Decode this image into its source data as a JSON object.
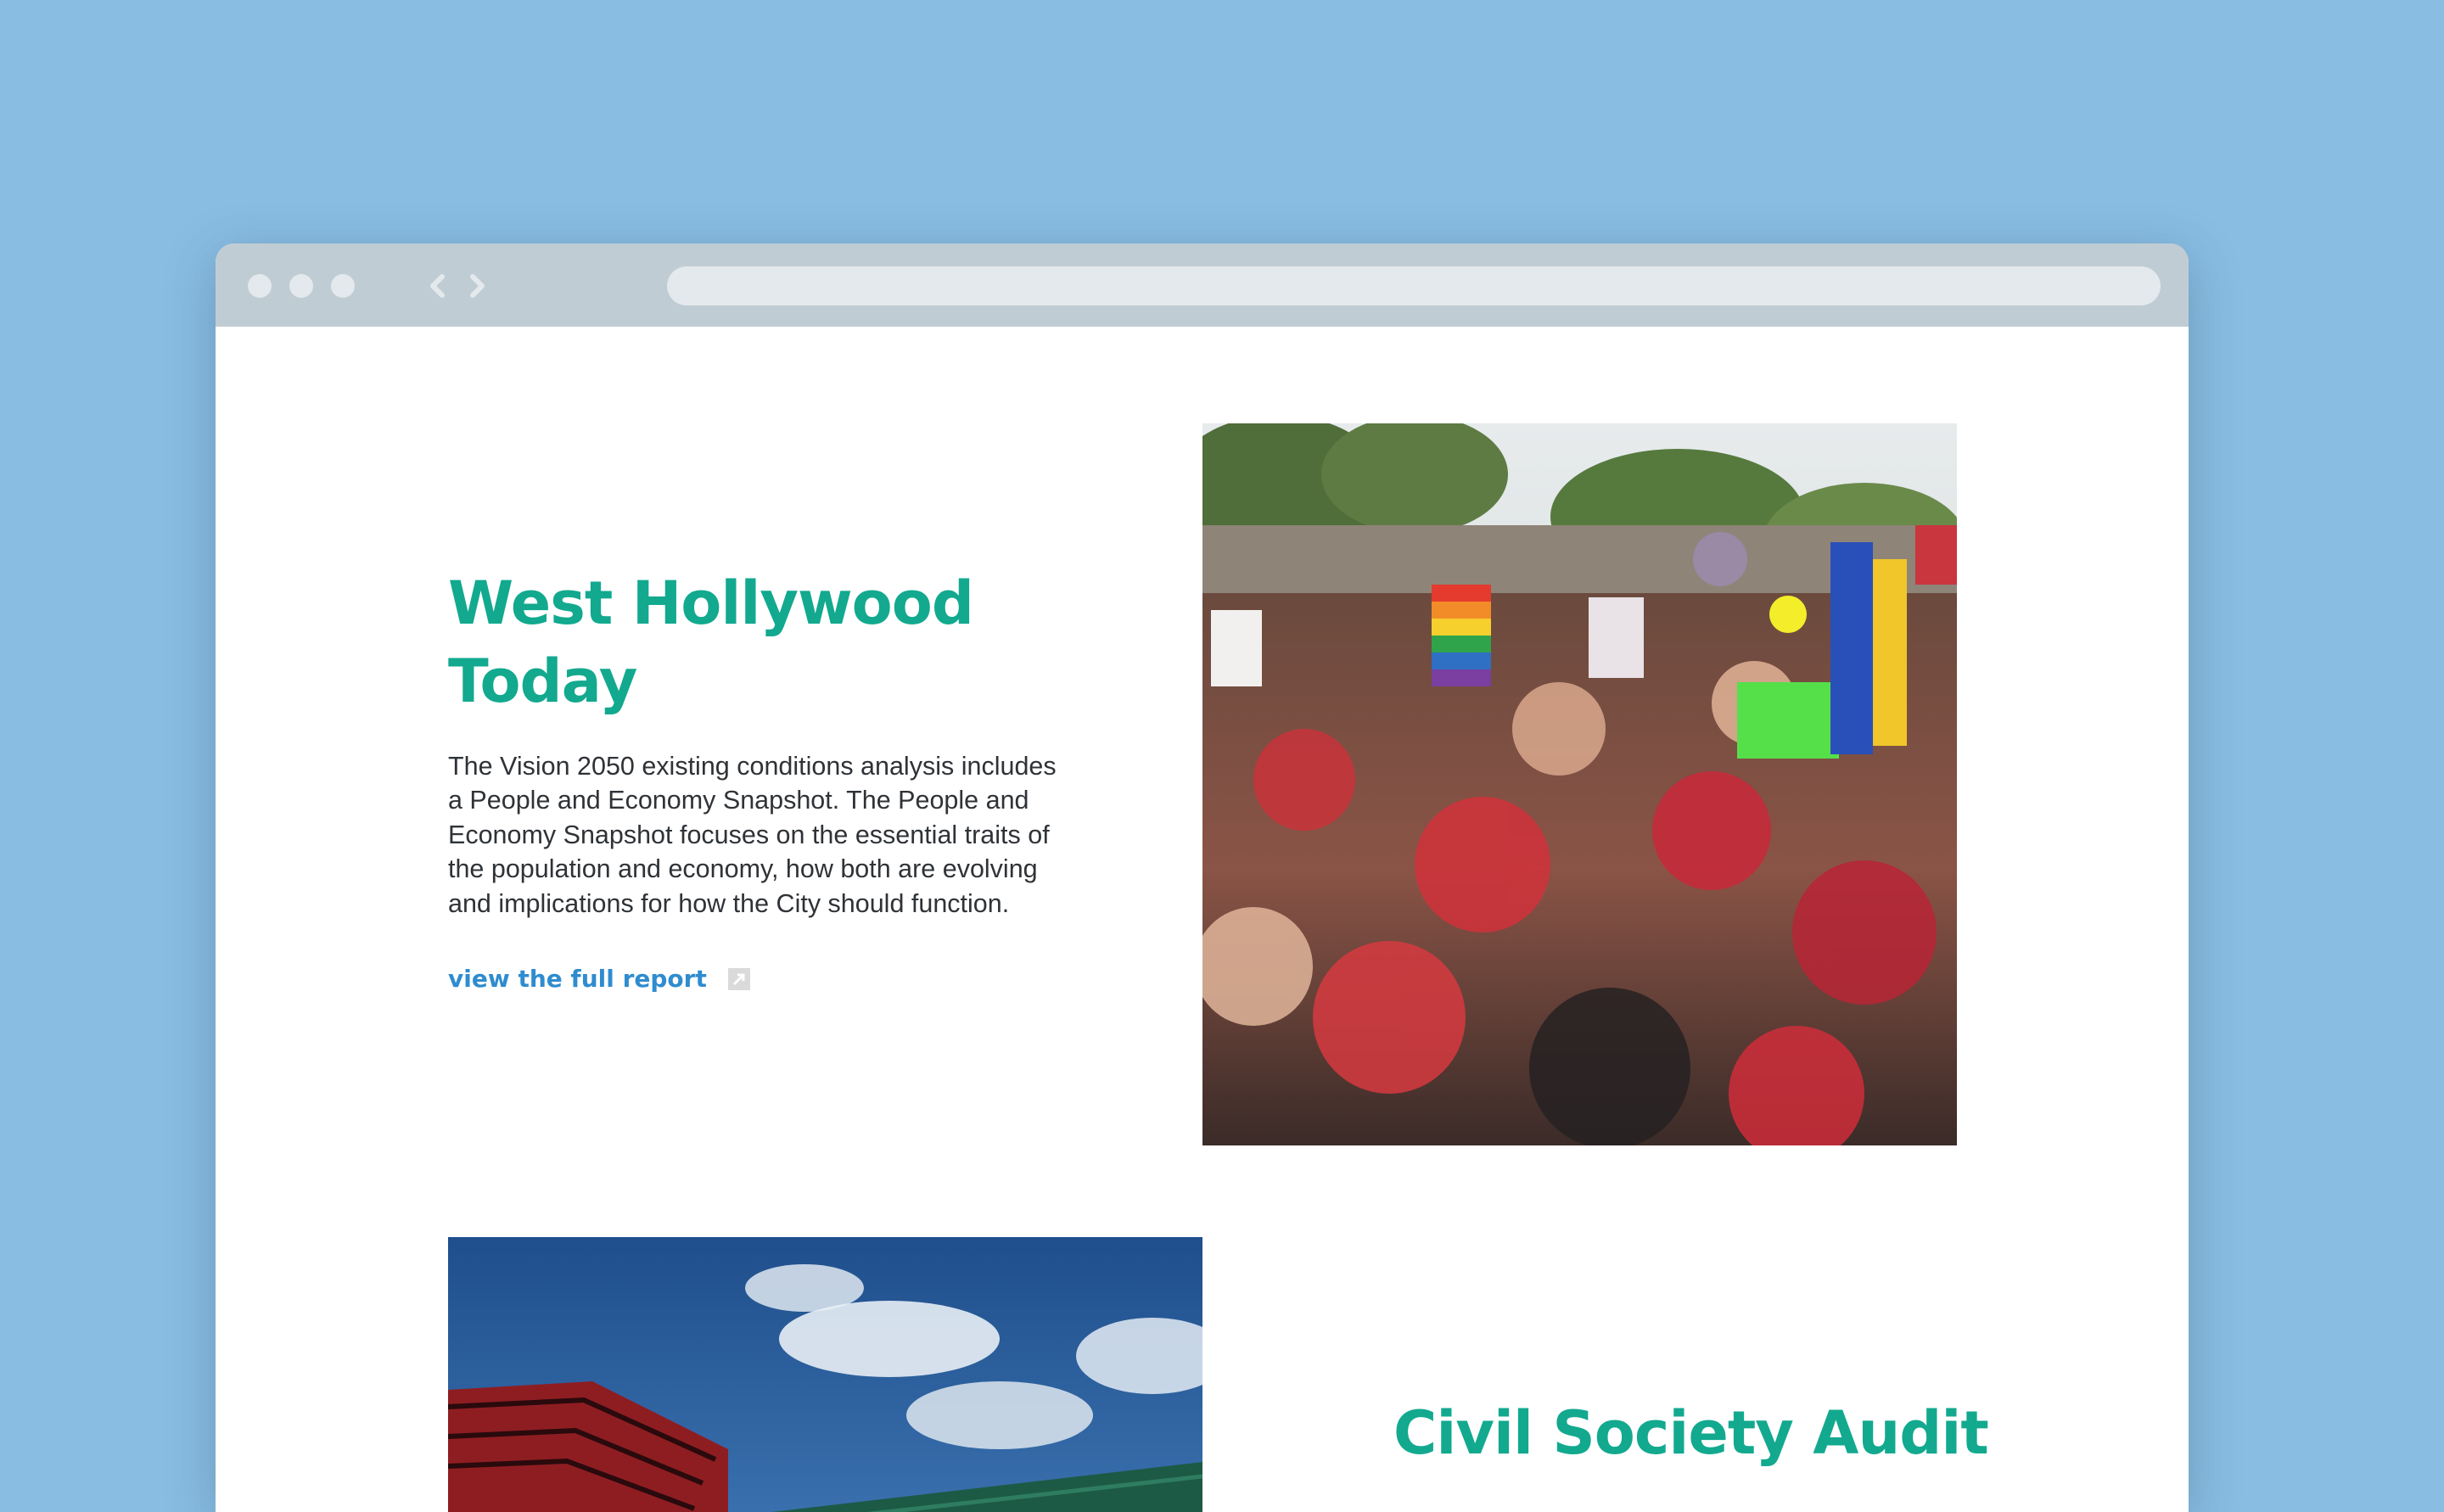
{
  "browser": {
    "window_controls": [
      "close-dot",
      "minimize-dot",
      "maximize-dot"
    ],
    "nav_icons": [
      "back-arrow-icon",
      "forward-arrow-icon"
    ]
  },
  "sections": [
    {
      "title": "West Hollywood Today",
      "body": "The Vision 2050 existing conditions analysis includes a People and Economy Snapshot. The People and Economy Snapshot focuses on the essential traits of the population and economy, how both are evolving and implications for how the City should function.",
      "link_label": "view the full report",
      "link_icon": "external-link-icon",
      "image": "pride-rally-crowd-photo"
    },
    {
      "title": "Civil Society Audit",
      "image": "red-building-skyline-photo"
    }
  ],
  "colors": {
    "page_background": "#89bde2",
    "chrome": "#c0ccd3",
    "title_teal": "#12a98f",
    "link_blue": "#2f8ccf",
    "body_text": "#2f3337"
  }
}
